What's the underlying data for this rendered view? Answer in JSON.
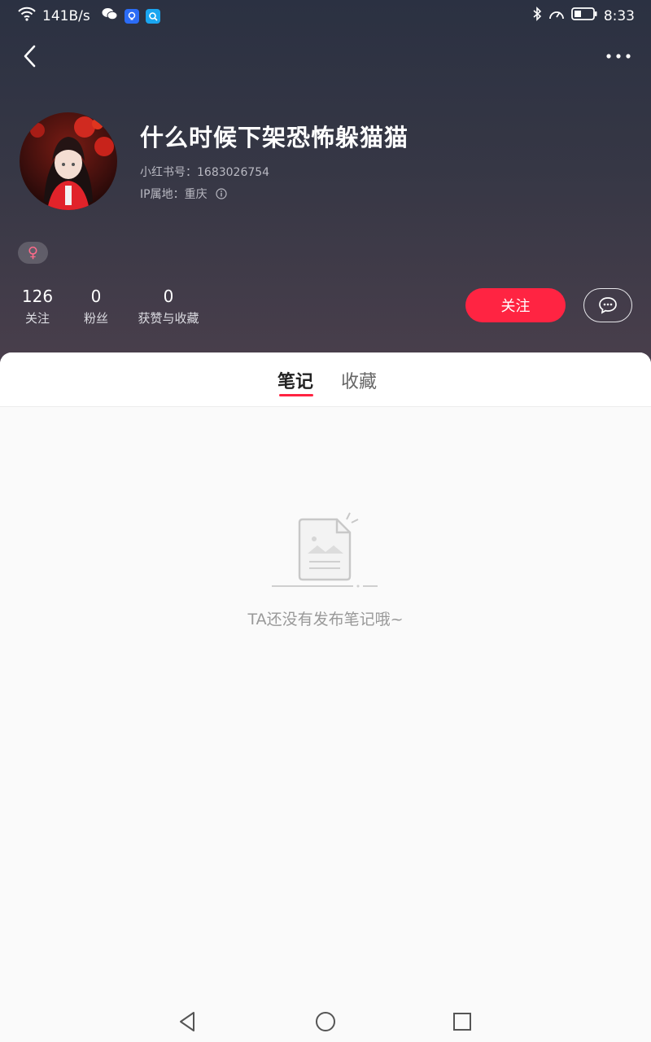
{
  "status_bar": {
    "network_speed": "141B/s",
    "time": "8:33",
    "icons": [
      "wifi-icon",
      "wechat-icon",
      "blue-app-icon",
      "search-app-icon",
      "bluetooth-icon",
      "speed-icon",
      "battery-icon"
    ]
  },
  "profile": {
    "nickname": "什么时候下架恐怖躲猫猫",
    "rid_label": "小红书号：",
    "rid_value": "1683026754",
    "ip_label": "IP属地：",
    "ip_value": "重庆",
    "gender_symbol": "♀"
  },
  "stats": [
    {
      "value": "126",
      "label": "关注"
    },
    {
      "value": "0",
      "label": "粉丝"
    },
    {
      "value": "0",
      "label": "获赞与收藏"
    }
  ],
  "actions": {
    "follow_label": "关注"
  },
  "tabs": [
    {
      "label": "笔记",
      "active": true
    },
    {
      "label": "收藏",
      "active": false
    }
  ],
  "empty_state": {
    "message": "TA还没有发布笔记哦~"
  },
  "colors": {
    "accent": "#ff2442",
    "header_bg_top": "#2b3142",
    "header_bg_bottom": "#4a3f4c"
  }
}
